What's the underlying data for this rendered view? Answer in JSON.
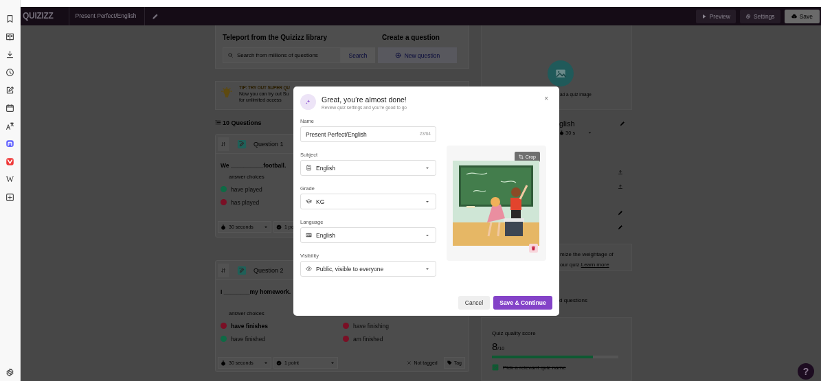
{
  "topbar": {
    "logo": "QUIZIZZ",
    "quiz_title": "Present Perfect/English",
    "buttons": [
      {
        "label": "Preview",
        "kind": "play"
      },
      {
        "label": "Settings",
        "kind": "gear"
      },
      {
        "label": "Save",
        "kind": "cloud"
      }
    ]
  },
  "sidebar": {
    "letter_icon": "W"
  },
  "library": {
    "title": "Teleport from the Quizizz library",
    "search_placeholder": "Search from millions of questions",
    "search_button": "Search",
    "create_title": "Create a question",
    "create_button": "New question"
  },
  "tip": {
    "title": "TIP: TRY OUT SUPER QU",
    "lines": [
      "Now you can try out Su",
      "for unlimited access"
    ]
  },
  "question_count": "10 Questions",
  "questions": [
    {
      "label": "Question 1",
      "text": "We __________football.",
      "choices_label": "answer choices",
      "choices": [
        {
          "text": "have played",
          "correct": true,
          "highlighted": false
        },
        {
          "text": "has played",
          "correct": false,
          "highlighted": false
        }
      ],
      "time": "30 seconds",
      "points": "1 po"
    },
    {
      "label": "Question 2",
      "text": "I ________my homework.",
      "choices_label": "answer choices",
      "choices": [
        {
          "text": "have finishes",
          "correct": false,
          "highlighted": true
        },
        {
          "text": "have finished",
          "correct": true,
          "highlighted": false
        },
        {
          "text": "have finishing",
          "correct": false,
          "highlighted": false
        },
        {
          "text": "am finished",
          "correct": false,
          "highlighted": false
        }
      ],
      "time": "30 seconds",
      "points": "1 point",
      "tag_status": "Not tagged",
      "tag_button": "Tag"
    }
  ],
  "right_panel": {
    "image_hint": "ad a quiz image",
    "title": "glish",
    "time": "30 s",
    "weightage_lines": [
      "mize the weightage of",
      "our quiz."
    ],
    "learn_more": "Learn more",
    "questions_fragment": "d questions",
    "quality": {
      "title": "Quiz quality score",
      "score": "8",
      "out_of": "/10",
      "level": 0.8,
      "checks": [
        {
          "label": "Pick a relevant quiz name",
          "checked": true
        }
      ]
    }
  },
  "modal": {
    "title": "Great, you’re almost done!",
    "subtitle": "Review quiz settings and you’re good to go",
    "close": "×",
    "fields": [
      {
        "label": "Name",
        "kind": "text",
        "value": "Present Perfect/English",
        "counter": "23/64"
      },
      {
        "label": "Subject",
        "kind": "select",
        "value": "English"
      },
      {
        "label": "Grade",
        "kind": "select",
        "value": "KG"
      },
      {
        "label": "Language",
        "kind": "select",
        "value": "English"
      },
      {
        "label": "Visibility",
        "kind": "select",
        "value": "Public, visible to everyone"
      }
    ],
    "image": {
      "kind": "picture",
      "crop_button": "Crop"
    },
    "buttons": [
      {
        "label": "Cancel",
        "kind": "secondary"
      },
      {
        "label": "Save & Continue",
        "kind": "primary"
      }
    ]
  },
  "help_button": "?"
}
